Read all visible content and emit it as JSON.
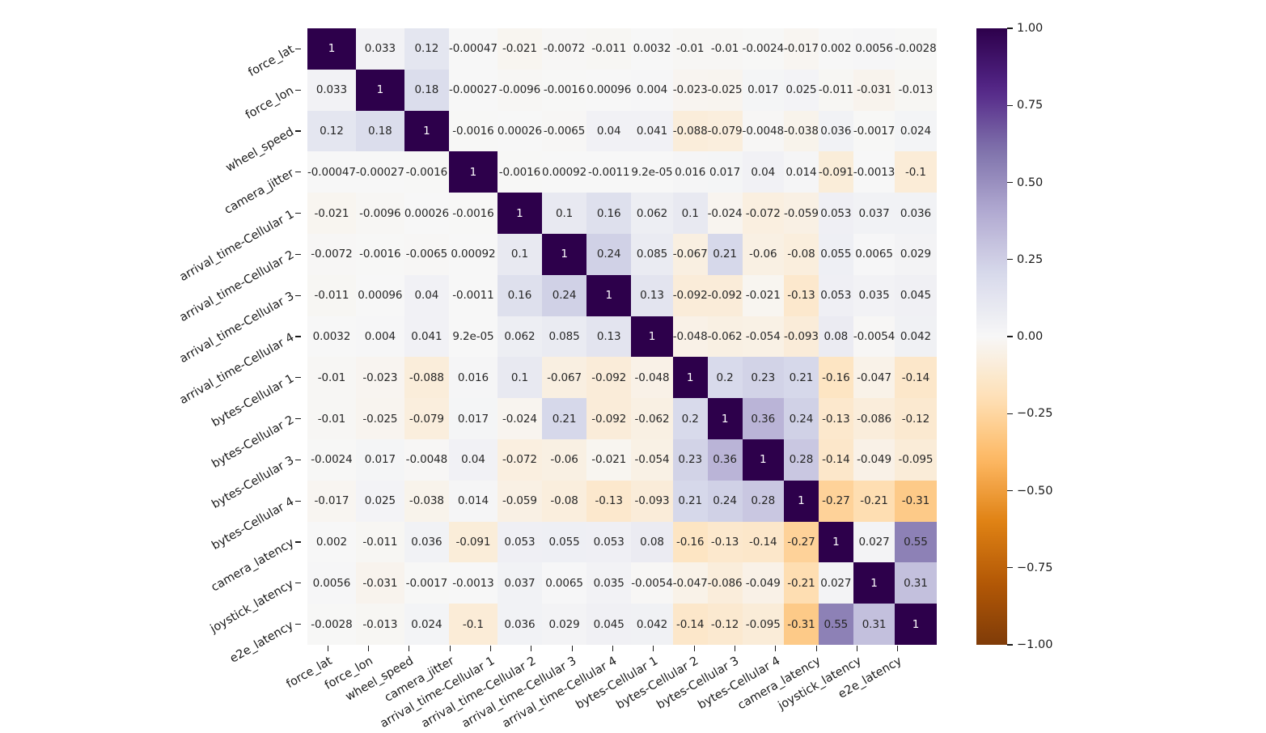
{
  "chart_data": {
    "type": "heatmap",
    "title": "",
    "xlabel": "",
    "ylabel": "",
    "colormap": "PuOr_r",
    "vmin": -1.0,
    "vmax": 1.0,
    "annotated": true,
    "grid": false,
    "legend_position": "right",
    "colorbar": {
      "ticks": [
        1.0,
        0.75,
        0.5,
        0.25,
        0.0,
        -0.25,
        -0.5,
        -0.75,
        -1.0
      ],
      "tick_labels": [
        "1.00",
        "0.75",
        "0.50",
        "0.25",
        "0.00",
        "−0.25",
        "−0.50",
        "−0.75",
        "−1.00"
      ],
      "low_color": "#7f3b08",
      "mid_color": "#f7f7f7",
      "high_color": "#2d004b"
    },
    "categories": [
      "force_lat",
      "force_lon",
      "wheel_speed",
      "camera_jitter",
      "arrival_time-Cellular 1",
      "arrival_time-Cellular 2",
      "arrival_time-Cellular 3",
      "arrival_time-Cellular 4",
      "bytes-Cellular 1",
      "bytes-Cellular 2",
      "bytes-Cellular 3",
      "bytes-Cellular 4",
      "camera_latency",
      "joystick_latency",
      "e2e_latency"
    ],
    "xticklabels": [
      "force_lat",
      "force_lon",
      "wheel_speed",
      "camera_jitter",
      "arrival_time-Cellular 1",
      "arrival_time-Cellular 2",
      "arrival_time-Cellular 3",
      "arrival_time-Cellular 4",
      "bytes-Cellular 1",
      "bytes-Cellular 2",
      "bytes-Cellular 3",
      "bytes-Cellular 4",
      "camera_latency",
      "joystick_latency",
      "e2e_latency"
    ],
    "yticklabels": [
      "force_lat",
      "force_lon",
      "wheel_speed",
      "camera_jitter",
      "arrival_time-Cellular 1",
      "arrival_time-Cellular 2",
      "arrival_time-Cellular 3",
      "arrival_time-Cellular 4",
      "bytes-Cellular 1",
      "bytes-Cellular 2",
      "bytes-Cellular 3",
      "bytes-Cellular 4",
      "camera_latency",
      "joystick_latency",
      "e2e_latency"
    ],
    "values": [
      [
        1,
        0.033,
        0.12,
        -0.00047,
        -0.021,
        -0.0072,
        -0.011,
        0.0032,
        -0.01,
        -0.01,
        -0.0024,
        -0.017,
        0.002,
        0.0056,
        -0.0028
      ],
      [
        0.033,
        1,
        0.18,
        -0.00027,
        -0.0096,
        -0.0016,
        0.00096,
        0.004,
        -0.023,
        -0.025,
        0.017,
        0.025,
        -0.011,
        -0.031,
        -0.013
      ],
      [
        0.12,
        0.18,
        1,
        -0.0016,
        0.00026,
        -0.0065,
        0.04,
        0.041,
        -0.088,
        -0.079,
        -0.0048,
        -0.038,
        0.036,
        -0.0017,
        0.024
      ],
      [
        -0.00047,
        -0.00027,
        -0.0016,
        1,
        -0.0016,
        0.00092,
        -0.0011,
        9.2e-05,
        0.016,
        0.017,
        0.04,
        0.014,
        -0.091,
        -0.0013,
        -0.1
      ],
      [
        -0.021,
        -0.0096,
        0.00026,
        -0.0016,
        1,
        0.1,
        0.16,
        0.062,
        0.1,
        -0.024,
        -0.072,
        -0.059,
        0.053,
        0.037,
        0.036
      ],
      [
        -0.0072,
        -0.0016,
        -0.0065,
        0.00092,
        0.1,
        1,
        0.24,
        0.085,
        -0.067,
        0.21,
        -0.06,
        -0.08,
        0.055,
        0.0065,
        0.029
      ],
      [
        -0.011,
        0.00096,
        0.04,
        -0.0011,
        0.16,
        0.24,
        1,
        0.13,
        -0.092,
        -0.092,
        -0.021,
        -0.13,
        0.053,
        0.035,
        0.045
      ],
      [
        0.0032,
        0.004,
        0.041,
        9.2e-05,
        0.062,
        0.085,
        0.13,
        1,
        -0.048,
        -0.062,
        -0.054,
        -0.093,
        0.08,
        -0.0054,
        0.042
      ],
      [
        -0.01,
        -0.023,
        -0.088,
        0.016,
        0.1,
        -0.067,
        -0.092,
        -0.048,
        1,
        0.2,
        0.23,
        0.21,
        -0.16,
        -0.047,
        -0.14
      ],
      [
        -0.01,
        -0.025,
        -0.079,
        0.017,
        -0.024,
        0.21,
        -0.092,
        -0.062,
        0.2,
        1,
        0.36,
        0.24,
        -0.13,
        -0.086,
        -0.12
      ],
      [
        -0.0024,
        0.017,
        -0.0048,
        0.04,
        -0.072,
        -0.06,
        -0.021,
        -0.054,
        0.23,
        0.36,
        1,
        0.28,
        -0.14,
        -0.049,
        -0.095
      ],
      [
        -0.017,
        0.025,
        -0.038,
        0.014,
        -0.059,
        -0.08,
        -0.13,
        -0.093,
        0.21,
        0.24,
        0.28,
        1,
        -0.27,
        -0.21,
        -0.31
      ],
      [
        0.002,
        -0.011,
        0.036,
        -0.091,
        0.053,
        0.055,
        0.053,
        0.08,
        -0.16,
        -0.13,
        -0.14,
        -0.27,
        1,
        0.027,
        0.55
      ],
      [
        0.0056,
        -0.031,
        -0.0017,
        -0.0013,
        0.037,
        0.0065,
        0.035,
        -0.0054,
        -0.047,
        -0.086,
        -0.049,
        -0.21,
        0.027,
        1,
        0.31
      ],
      [
        -0.0028,
        -0.013,
        0.024,
        -0.1,
        0.036,
        0.029,
        0.045,
        0.042,
        -0.14,
        -0.12,
        -0.095,
        -0.31,
        0.55,
        0.31,
        1
      ]
    ],
    "annotations": [
      [
        "1",
        "0.033",
        "0.12",
        "-0.00047",
        "-0.021",
        "-0.0072",
        "-0.011",
        "0.0032",
        "-0.01",
        "-0.01",
        "-0.0024",
        "-0.017",
        "0.002",
        "0.0056",
        "-0.0028"
      ],
      [
        "0.033",
        "1",
        "0.18",
        "-0.00027",
        "-0.0096",
        "-0.0016",
        "0.00096",
        "0.004",
        "-0.023",
        "-0.025",
        "0.017",
        "0.025",
        "-0.011",
        "-0.031",
        "-0.013"
      ],
      [
        "0.12",
        "0.18",
        "1",
        "-0.0016",
        "0.00026",
        "-0.0065",
        "0.04",
        "0.041",
        "-0.088",
        "-0.079",
        "-0.0048",
        "-0.038",
        "0.036",
        "-0.0017",
        "0.024"
      ],
      [
        "-0.00047",
        "-0.00027",
        "-0.0016",
        "1",
        "-0.0016",
        "0.00092",
        "-0.0011",
        "9.2e-05",
        "0.016",
        "0.017",
        "0.04",
        "0.014",
        "-0.091",
        "-0.0013",
        "-0.1"
      ],
      [
        "-0.021",
        "-0.0096",
        "0.00026",
        "-0.0016",
        "1",
        "0.1",
        "0.16",
        "0.062",
        "0.1",
        "-0.024",
        "-0.072",
        "-0.059",
        "0.053",
        "0.037",
        "0.036"
      ],
      [
        "-0.0072",
        "-0.0016",
        "-0.0065",
        "0.00092",
        "0.1",
        "1",
        "0.24",
        "0.085",
        "-0.067",
        "0.21",
        "-0.06",
        "-0.08",
        "0.055",
        "0.0065",
        "0.029"
      ],
      [
        "-0.011",
        "0.00096",
        "0.04",
        "-0.0011",
        "0.16",
        "0.24",
        "1",
        "0.13",
        "-0.092",
        "-0.092",
        "-0.021",
        "-0.13",
        "0.053",
        "0.035",
        "0.045"
      ],
      [
        "0.0032",
        "0.004",
        "0.041",
        "9.2e-05",
        "0.062",
        "0.085",
        "0.13",
        "1",
        "-0.048",
        "-0.062",
        "-0.054",
        "-0.093",
        "0.08",
        "-0.0054",
        "0.042"
      ],
      [
        "-0.01",
        "-0.023",
        "-0.088",
        "0.016",
        "0.1",
        "-0.067",
        "-0.092",
        "-0.048",
        "1",
        "0.2",
        "0.23",
        "0.21",
        "-0.16",
        "-0.047",
        "-0.14"
      ],
      [
        "-0.01",
        "-0.025",
        "-0.079",
        "0.017",
        "-0.024",
        "0.21",
        "-0.092",
        "-0.062",
        "0.2",
        "1",
        "0.36",
        "0.24",
        "-0.13",
        "-0.086",
        "-0.12"
      ],
      [
        "-0.0024",
        "0.017",
        "-0.0048",
        "0.04",
        "-0.072",
        "-0.06",
        "-0.021",
        "-0.054",
        "0.23",
        "0.36",
        "1",
        "0.28",
        "-0.14",
        "-0.049",
        "-0.095"
      ],
      [
        "-0.017",
        "0.025",
        "-0.038",
        "0.014",
        "-0.059",
        "-0.08",
        "-0.13",
        "-0.093",
        "0.21",
        "0.24",
        "0.28",
        "1",
        "-0.27",
        "-0.21",
        "-0.31"
      ],
      [
        "0.002",
        "-0.011",
        "0.036",
        "-0.091",
        "0.053",
        "0.055",
        "0.053",
        "0.08",
        "-0.16",
        "-0.13",
        "-0.14",
        "-0.27",
        "1",
        "0.027",
        "0.55"
      ],
      [
        "0.0056",
        "-0.031",
        "-0.0017",
        "-0.0013",
        "0.037",
        "0.0065",
        "0.035",
        "-0.0054",
        "-0.047",
        "-0.086",
        "-0.049",
        "-0.21",
        "0.027",
        "1",
        "0.31"
      ],
      [
        "-0.0028",
        "-0.013",
        "0.024",
        "-0.1",
        "0.036",
        "0.029",
        "0.045",
        "0.042",
        "-0.14",
        "-0.12",
        "-0.095",
        "-0.31",
        "0.55",
        "0.31",
        "1"
      ]
    ]
  }
}
